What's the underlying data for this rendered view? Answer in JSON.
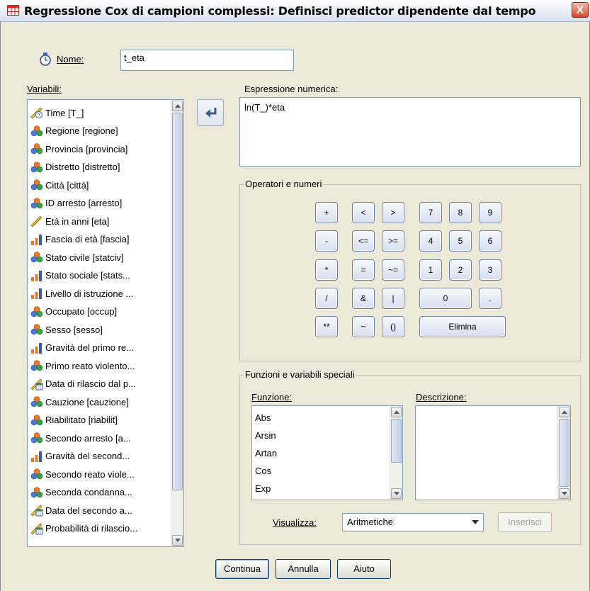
{
  "window": {
    "title": "Regressione Cox di campioni complessi: Definisci predictor dipendente dal tempo",
    "close_glyph": "X"
  },
  "name_field": {
    "label": "Nome:",
    "value": "t_eta",
    "icon": "stopwatch-icon"
  },
  "variables": {
    "label": "Variabili:",
    "items": [
      {
        "label": "Time [T_]",
        "icon": "time-ruler-icon"
      },
      {
        "label": "Regione [regione]",
        "icon": "nominal-icon"
      },
      {
        "label": "Provincia [provincia]",
        "icon": "nominal-icon"
      },
      {
        "label": "Distretto [distretto]",
        "icon": "nominal-icon"
      },
      {
        "label": "Città [città]",
        "icon": "nominal-icon"
      },
      {
        "label": "ID arresto [arresto]",
        "icon": "nominal-icon"
      },
      {
        "label": "Età in anni [eta]",
        "icon": "scale-ruler-icon"
      },
      {
        "label": "Fascia di età [fascia]",
        "icon": "ordinal-bars-icon"
      },
      {
        "label": "Stato civile [statciv]",
        "icon": "nominal-icon"
      },
      {
        "label": "Stato sociale [stats...",
        "icon": "ordinal-bars-icon"
      },
      {
        "label": "Livello di istruzione ...",
        "icon": "ordinal-bars-icon"
      },
      {
        "label": "Occupato [occup]",
        "icon": "nominal-icon"
      },
      {
        "label": "Sesso [sesso]",
        "icon": "nominal-icon"
      },
      {
        "label": "Gravità del primo re...",
        "icon": "ordinal-bars-icon"
      },
      {
        "label": "Primo reato violento...",
        "icon": "nominal-icon"
      },
      {
        "label": "Data di rilascio dal p...",
        "icon": "date-ruler-icon"
      },
      {
        "label": "Cauzione [cauzione]",
        "icon": "nominal-icon"
      },
      {
        "label": "Riabilitato [riabilit]",
        "icon": "nominal-icon"
      },
      {
        "label": "Secondo arresto [a...",
        "icon": "nominal-icon"
      },
      {
        "label": "Gravità del second...",
        "icon": "ordinal-bars-icon"
      },
      {
        "label": "Secondo reato viole...",
        "icon": "nominal-icon"
      },
      {
        "label": "Seconda condanna...",
        "icon": "nominal-icon"
      },
      {
        "label": "Data del secondo a...",
        "icon": "date-ruler-icon"
      },
      {
        "label": "Probabilità di rilascio...",
        "icon": "date-ruler-icon"
      }
    ]
  },
  "expression": {
    "label": "Espressione numerica:",
    "value": "ln(T_)*eta"
  },
  "operators": {
    "title": "Operatori e numeri",
    "keys": [
      "+",
      "<",
      ">",
      "7",
      "8",
      "9",
      "-",
      "<=",
      ">=",
      "4",
      "5",
      "6",
      "*",
      "=",
      "~=",
      "1",
      "2",
      "3",
      "/",
      "&",
      "|",
      "0",
      ".",
      "**",
      "~",
      "()",
      "Elimina"
    ]
  },
  "functions": {
    "title": "Funzioni e variabili speciali",
    "function_label": "Funzione:",
    "description_label": "Descrizione:",
    "items": [
      "Abs",
      "Arsin",
      "Artan",
      "Cos",
      "Exp"
    ],
    "description": "",
    "view_label": "Visualizza:",
    "view_value": "Aritmetiche",
    "insert_label": "Inserisci"
  },
  "buttons": {
    "continue": "Continua",
    "cancel": "Annulla",
    "help": "Aiuto"
  }
}
